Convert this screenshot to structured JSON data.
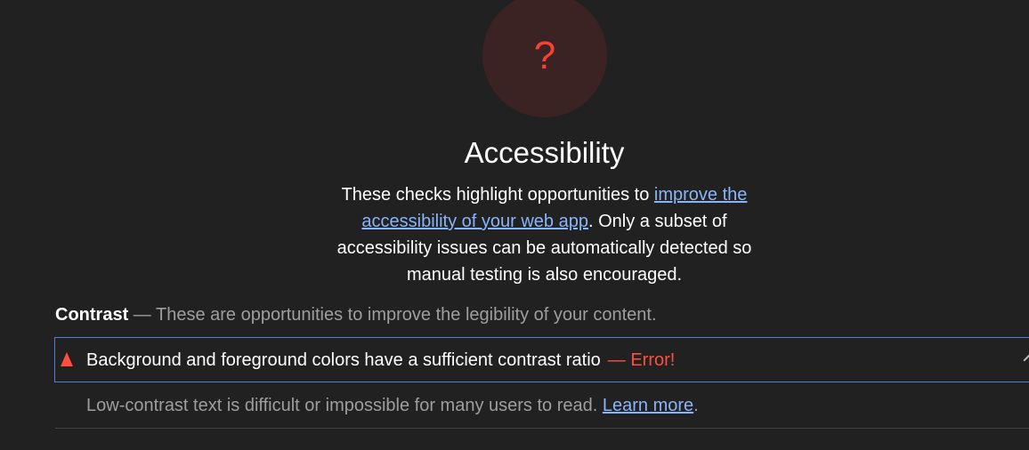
{
  "category": {
    "score_symbol": "?",
    "title": "Accessibility",
    "description": {
      "prefix": "These checks highlight opportunities to ",
      "link": "improve the accessibility of your web app",
      "suffix": ". Only a subset of accessibility issues can be automatically detected so manual testing is also encouraged."
    }
  },
  "group": {
    "title": "Contrast",
    "description": " — These are opportunities to improve the legibility of your content."
  },
  "audit": {
    "icon": "fail-triangle-icon",
    "title": "Background and foreground colors have a sufficient contrast ratio",
    "error": "— Error!",
    "expanded_icon": "chevron-up-icon",
    "details_text": "Low-contrast text is difficult or impossible for many users to read. ",
    "details_link": "Learn more",
    "details_end": "."
  },
  "colors": {
    "background": "#212121",
    "error": "#ff4e42",
    "link": "#8ab4f8",
    "focus_border": "#4d7fdd"
  }
}
